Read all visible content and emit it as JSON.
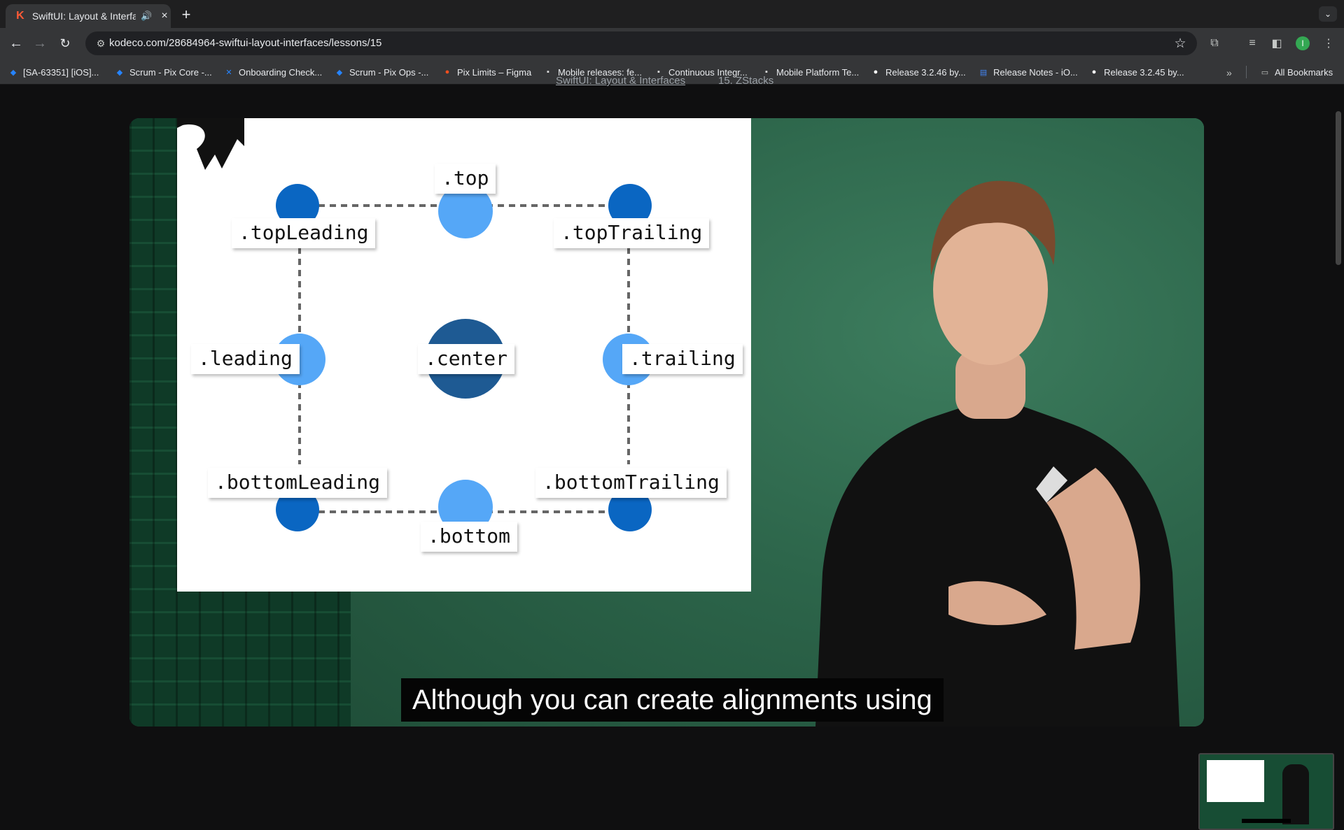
{
  "browser": {
    "tab": {
      "title": "SwiftUI: Layout & Interfac",
      "favicon": "K",
      "audio_icon": "speaker-icon",
      "close_icon": "close-icon"
    },
    "url": "kodeco.com/28684964-swiftui-layout-interfaces/lessons/15",
    "profile_initial": "I",
    "bookmarks": [
      {
        "label": "[SA-63351] [iOS]...",
        "icon": "jira-icon"
      },
      {
        "label": "Scrum - Pix Core -...",
        "icon": "jira-icon"
      },
      {
        "label": "Onboarding Check...",
        "icon": "confluence-icon"
      },
      {
        "label": "Scrum - Pix Ops -...",
        "icon": "jira-icon"
      },
      {
        "label": "Pix Limits – Figma",
        "icon": "figma-icon"
      },
      {
        "label": "Mobile releases: fe...",
        "icon": "notion-icon"
      },
      {
        "label": "Continuous Integr...",
        "icon": "notion-icon"
      },
      {
        "label": "Mobile Platform Te...",
        "icon": "notion-icon"
      },
      {
        "label": "Release 3.2.46 by...",
        "icon": "github-icon"
      },
      {
        "label": "Release Notes - iO...",
        "icon": "docs-icon"
      },
      {
        "label": "Release 3.2.45 by...",
        "icon": "github-icon"
      }
    ],
    "all_bookmarks": "All Bookmarks"
  },
  "page": {
    "breadcrumb_course": "SwiftUI: Layout & Interfaces",
    "breadcrumb_lesson": "15. ZStacks"
  },
  "video": {
    "slide_labels": {
      "top": ".top",
      "topLeading": ".topLeading",
      "topTrailing": ".topTrailing",
      "leading": ".leading",
      "center": ".center",
      "trailing": ".trailing",
      "bottomLeading": ".bottomLeading",
      "bottom": ".bottom",
      "bottomTrailing": ".bottomTrailing"
    },
    "caption": "Although you can create alignments using"
  },
  "colors": {
    "accent": "#ff5a36",
    "circle_dark": "#0a66c2",
    "circle_light": "#55a7f7",
    "circle_center": "#1e5a93",
    "video_green": "#2f6b52"
  }
}
